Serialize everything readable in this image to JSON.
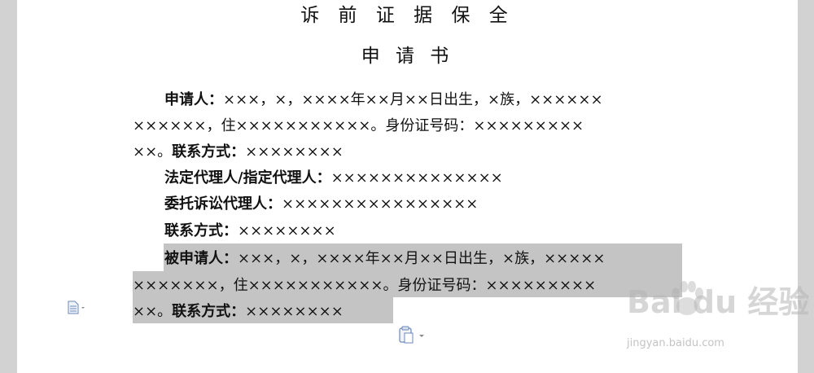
{
  "document": {
    "title_line1": "诉 前 证 据 保 全",
    "title_line2": "申 请 书",
    "paragraphs": [
      {
        "label": "申请人：",
        "text": "×××，×，××××年××月××日出生，×族，××××××"
      },
      {
        "label": "",
        "text": "××××××，住×××××××××××。身份证号码：×××××××××"
      },
      {
        "label": "",
        "text": "××。",
        "label2": "联系方式：",
        "text2": "××××××××"
      },
      {
        "label": "法定代理人/指定代理人：",
        "text": "××××××××××××××"
      },
      {
        "label": "委托诉讼代理人：",
        "text": "××××××××××××××××"
      },
      {
        "label": "联系方式：",
        "text": "××××××××"
      },
      {
        "label": "被申请人：",
        "text": "×××，×，××××年××月××日出生，×族，×××××"
      },
      {
        "label": "",
        "text": "×××××××，住×××××××××××。身份证号码：×××××××××"
      },
      {
        "label": "",
        "text": "××。",
        "label2": "联系方式：",
        "text2": "××××××××"
      }
    ]
  },
  "watermark": {
    "brand": "Bai du 经验",
    "url": "jingyan.baidu.com"
  },
  "icons": {
    "doc_icon": "document-icon",
    "paste_icon": "paste-options-icon"
  }
}
